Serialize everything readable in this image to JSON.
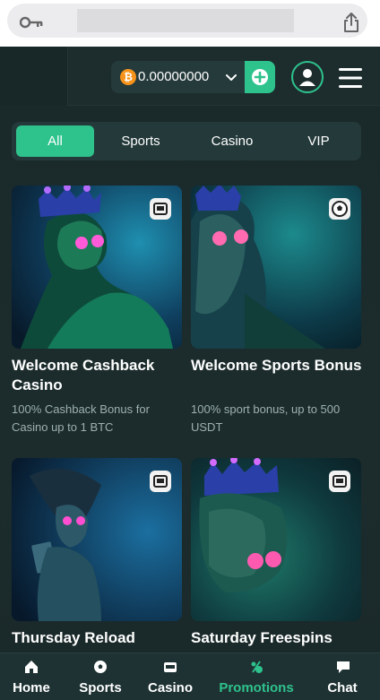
{
  "header": {
    "balance": "0.00000000",
    "currency_symbol": "₿"
  },
  "tabs": [
    {
      "label": "All",
      "active": true
    },
    {
      "label": "Sports",
      "active": false
    },
    {
      "label": "Casino",
      "active": false
    },
    {
      "label": "VIP",
      "active": false
    }
  ],
  "promotions": [
    {
      "title": "Welcome Cashback Casino",
      "description": "100% Cashback Bonus for Casino up to 1 BTC",
      "badge_icon": "slot-machine-icon"
    },
    {
      "title": "Welcome Sports Bonus",
      "description": "100% sport bonus, up to 500 USDT",
      "badge_icon": "soccer-ball-icon"
    },
    {
      "title": "Thursday Reload",
      "description": "",
      "badge_icon": "slot-machine-icon"
    },
    {
      "title": "Saturday Freespins",
      "description": "",
      "badge_icon": "slot-machine-icon"
    }
  ],
  "bottom_nav": [
    {
      "label": "Home",
      "icon": "home-icon",
      "active": false
    },
    {
      "label": "Sports",
      "icon": "soccer-ball-icon",
      "active": false
    },
    {
      "label": "Casino",
      "icon": "slot-machine-icon",
      "active": false
    },
    {
      "label": "Promotions",
      "icon": "promotions-icon",
      "active": true
    },
    {
      "label": "Chat",
      "icon": "chat-icon",
      "active": false
    }
  ],
  "colors": {
    "accent": "#2ec28d",
    "background": "#1c2c2d",
    "tab_bar": "#24393a",
    "muted_text": "#9db0b0",
    "bitcoin": "#f7931a"
  }
}
